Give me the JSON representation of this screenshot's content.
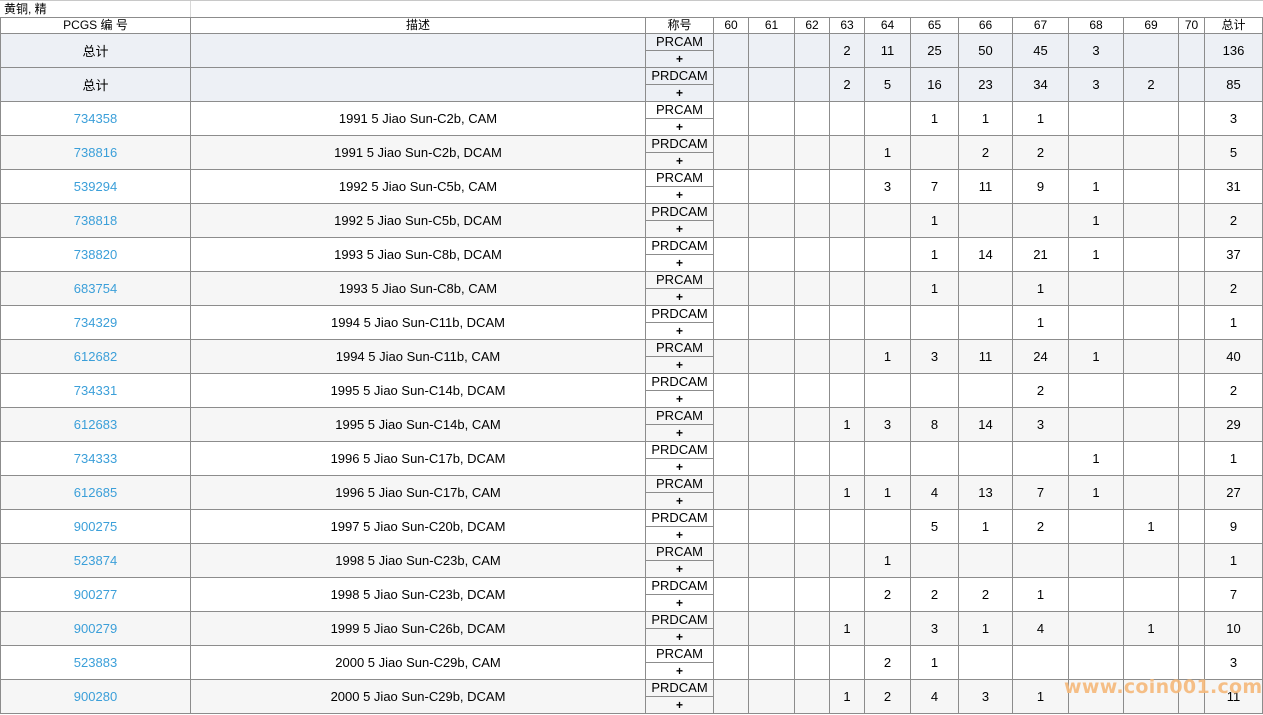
{
  "section_title": "黄铜, 精",
  "headers": {
    "pcgs": "PCGS 编 号",
    "desc": "描述",
    "desig": "称号",
    "grades": [
      "60",
      "61",
      "62",
      "63",
      "64",
      "65",
      "66",
      "67",
      "68",
      "69",
      "70"
    ],
    "total": "总计"
  },
  "rows": [
    {
      "type": "summary",
      "pcgs": "总计",
      "desc": "",
      "desig": "PRCAM",
      "plus": "+",
      "g": [
        "",
        "",
        "",
        "2",
        "11",
        "25",
        "50",
        "45",
        "3",
        "",
        ""
      ],
      "total": "136"
    },
    {
      "type": "summary",
      "pcgs": "总计",
      "desc": "",
      "desig": "PRDCAM",
      "plus": "+",
      "g": [
        "",
        "",
        "",
        "2",
        "5",
        "16",
        "23",
        "34",
        "3",
        "2",
        ""
      ],
      "total": "85"
    },
    {
      "type": "item",
      "pcgs": "734358",
      "desc": "1991 5 Jiao Sun-C2b, CAM",
      "desig": "PRCAM",
      "plus": "+",
      "g": [
        "",
        "",
        "",
        "",
        "",
        "1",
        "1",
        "1",
        "",
        "",
        ""
      ],
      "total": "3"
    },
    {
      "type": "item",
      "pcgs": "738816",
      "desc": "1991 5 Jiao Sun-C2b, DCAM",
      "desig": "PRDCAM",
      "plus": "+",
      "g": [
        "",
        "",
        "",
        "",
        "1",
        "",
        "2",
        "2",
        "",
        "",
        ""
      ],
      "total": "5"
    },
    {
      "type": "item",
      "pcgs": "539294",
      "desc": "1992 5 Jiao Sun-C5b, CAM",
      "desig": "PRCAM",
      "plus": "+",
      "g": [
        "",
        "",
        "",
        "",
        "3",
        "7",
        "11",
        "9",
        "1",
        "",
        ""
      ],
      "total": "31"
    },
    {
      "type": "item",
      "pcgs": "738818",
      "desc": "1992 5 Jiao Sun-C5b, DCAM",
      "desig": "PRDCAM",
      "plus": "+",
      "g": [
        "",
        "",
        "",
        "",
        "",
        "1",
        "",
        "",
        "1",
        "",
        ""
      ],
      "total": "2"
    },
    {
      "type": "item",
      "pcgs": "738820",
      "desc": "1993 5 Jiao Sun-C8b, DCAM",
      "desig": "PRDCAM",
      "plus": "+",
      "g": [
        "",
        "",
        "",
        "",
        "",
        "1",
        "14",
        "21",
        "1",
        "",
        ""
      ],
      "total": "37"
    },
    {
      "type": "item",
      "pcgs": "683754",
      "desc": "1993 5 Jiao Sun-C8b, CAM",
      "desig": "PRCAM",
      "plus": "+",
      "g": [
        "",
        "",
        "",
        "",
        "",
        "1",
        "",
        "1",
        "",
        "",
        ""
      ],
      "total": "2"
    },
    {
      "type": "item",
      "pcgs": "734329",
      "desc": "1994 5 Jiao Sun-C11b, DCAM",
      "desig": "PRDCAM",
      "plus": "+",
      "g": [
        "",
        "",
        "",
        "",
        "",
        "",
        "",
        "1",
        "",
        "",
        ""
      ],
      "total": "1"
    },
    {
      "type": "item",
      "pcgs": "612682",
      "desc": "1994 5 Jiao Sun-C11b, CAM",
      "desig": "PRCAM",
      "plus": "+",
      "g": [
        "",
        "",
        "",
        "",
        "1",
        "3",
        "11",
        "24",
        "1",
        "",
        ""
      ],
      "total": "40"
    },
    {
      "type": "item",
      "pcgs": "734331",
      "desc": "1995 5 Jiao Sun-C14b, DCAM",
      "desig": "PRDCAM",
      "plus": "+",
      "g": [
        "",
        "",
        "",
        "",
        "",
        "",
        "",
        "2",
        "",
        "",
        ""
      ],
      "total": "2"
    },
    {
      "type": "item",
      "pcgs": "612683",
      "desc": "1995 5 Jiao Sun-C14b, CAM",
      "desig": "PRCAM",
      "plus": "+",
      "g": [
        "",
        "",
        "",
        "1",
        "3",
        "8",
        "14",
        "3",
        "",
        "",
        ""
      ],
      "total": "29"
    },
    {
      "type": "item",
      "pcgs": "734333",
      "desc": "1996 5 Jiao Sun-C17b, DCAM",
      "desig": "PRDCAM",
      "plus": "+",
      "g": [
        "",
        "",
        "",
        "",
        "",
        "",
        "",
        "",
        "1",
        "",
        ""
      ],
      "total": "1"
    },
    {
      "type": "item",
      "pcgs": "612685",
      "desc": "1996 5 Jiao Sun-C17b, CAM",
      "desig": "PRCAM",
      "plus": "+",
      "g": [
        "",
        "",
        "",
        "1",
        "1",
        "4",
        "13",
        "7",
        "1",
        "",
        ""
      ],
      "total": "27"
    },
    {
      "type": "item",
      "pcgs": "900275",
      "desc": "1997 5 Jiao Sun-C20b, DCAM",
      "desig": "PRDCAM",
      "plus": "+",
      "g": [
        "",
        "",
        "",
        "",
        "",
        "5",
        "1",
        "2",
        "",
        "1",
        ""
      ],
      "total": "9"
    },
    {
      "type": "item",
      "pcgs": "523874",
      "desc": "1998 5 Jiao Sun-C23b, CAM",
      "desig": "PRCAM",
      "plus": "+",
      "g": [
        "",
        "",
        "",
        "",
        "1",
        "",
        "",
        "",
        "",
        "",
        ""
      ],
      "total": "1"
    },
    {
      "type": "item",
      "pcgs": "900277",
      "desc": "1998 5 Jiao Sun-C23b, DCAM",
      "desig": "PRDCAM",
      "plus": "+",
      "g": [
        "",
        "",
        "",
        "",
        "2",
        "2",
        "2",
        "1",
        "",
        "",
        ""
      ],
      "total": "7"
    },
    {
      "type": "item",
      "pcgs": "900279",
      "desc": "1999 5 Jiao Sun-C26b, DCAM",
      "desig": "PRDCAM",
      "plus": "+",
      "g": [
        "",
        "",
        "",
        "1",
        "",
        "3",
        "1",
        "4",
        "",
        "1",
        ""
      ],
      "total": "10"
    },
    {
      "type": "item",
      "pcgs": "523883",
      "desc": "2000 5 Jiao Sun-C29b, CAM",
      "desig": "PRCAM",
      "plus": "+",
      "g": [
        "",
        "",
        "",
        "",
        "2",
        "1",
        "",
        "",
        "",
        "",
        ""
      ],
      "total": "3"
    },
    {
      "type": "item",
      "pcgs": "900280",
      "desc": "2000 5 Jiao Sun-C29b, DCAM",
      "desig": "PRDCAM",
      "plus": "+",
      "g": [
        "",
        "",
        "",
        "1",
        "2",
        "4",
        "3",
        "1",
        "",
        "",
        ""
      ],
      "total": "11"
    }
  ],
  "watermark": "www.coin001.com",
  "colors": {
    "link": "#3b9fd9",
    "summary_bg": "#edf0f5",
    "alt_row_bg": "#f6f6f6",
    "grid": "#8c8c8c",
    "watermark": "#f5b97a"
  }
}
